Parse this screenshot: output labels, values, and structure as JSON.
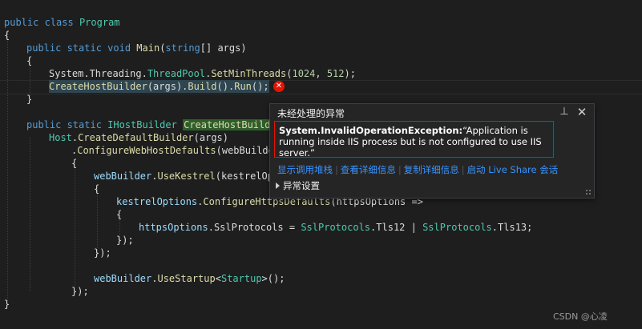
{
  "code": {
    "line0": {
      "kw": "public",
      "kw2": "class",
      "cls": "Program"
    },
    "open_brace": "{",
    "close_brace": "}",
    "main_sig": {
      "mods": "public static void",
      "name": "Main",
      "open": "(",
      "type": "string",
      "rest": "[] args)"
    },
    "threadpool": {
      "ns": "System.Threading.",
      "cls": "ThreadPool",
      "dot": ".",
      "method": "SetMinThreads",
      "open": "(",
      "n1": "1024",
      "sep": ", ",
      "n2": "512",
      "close": ");"
    },
    "host_run": {
      "method": "CreateHostBuilder",
      "args": "(args).",
      "build": "Build",
      "mid": "().",
      "run": "Run",
      "end": "();"
    },
    "builder_sig": {
      "mods": "public static",
      "type": "IHostBuilder",
      "name": "CreateHostBuilde"
    },
    "host_line": {
      "cls": "Host",
      "dot": ".",
      "method": "CreateDefaultBuilder",
      "rest": "(args)"
    },
    "configure": {
      "dot": ".",
      "method": "ConfigureWebHostDefaults",
      "rest": "(webBuilde"
    },
    "kestrel": {
      "obj": "webBuilder",
      "dot": ".",
      "method": "UseKestrel",
      "rest": "(kestrelOpt"
    },
    "https_defaults": {
      "obj": "kestrelOptions",
      "dot": ".",
      "method": "ConfigureHttpsDefaults",
      "rest": "(httpsOptions =>"
    },
    "ssl": {
      "obj": "httpsOptions",
      "dot": ".",
      "prop": "SslProtocols",
      "eq": " = ",
      "t1": "SslProtocols",
      "d1": ".",
      "v1": "Tls12",
      "pipe": " | ",
      "t2": "SslProtocols",
      "d2": ".",
      "v2": "Tls13",
      "end": ";"
    },
    "close_paren": "});",
    "startup": {
      "obj": "webBuilder",
      "dot": ".",
      "method": "UseStartup",
      "lt": "<",
      "type": "Startup",
      "gt": ">",
      "end": "();"
    }
  },
  "exception_popup": {
    "title": "未经处理的异常",
    "exception_type": "System.InvalidOperationException:",
    "message": "“Application is running inside IIS process but is not configured to use IIS server.”",
    "actions": [
      "显示调用堆栈",
      "查看详细信息",
      "复制详细信息",
      "启动 Live Share 会话"
    ],
    "settings_label": "异常设置"
  },
  "watermark": "CSDN @心凌",
  "colors": {
    "error": "#e51400",
    "link": "#3794ff",
    "keyword": "#569cd6",
    "type": "#4ec9b0"
  }
}
